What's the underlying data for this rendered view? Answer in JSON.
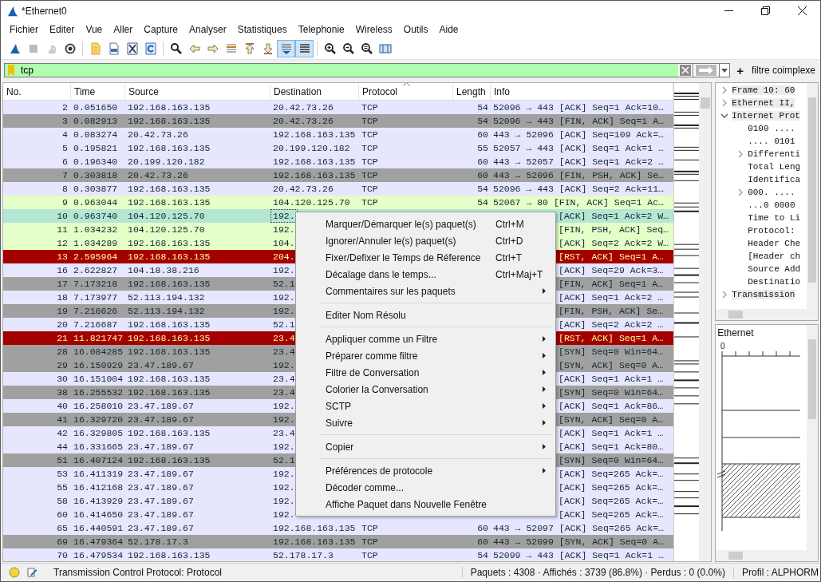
{
  "window": {
    "title": "*Ethernet0"
  },
  "menu_bar": [
    "Fichier",
    "Editer",
    "Vue",
    "Aller",
    "Capture",
    "Analyser",
    "Statistiques",
    "Telephonie",
    "Wireless",
    "Outils",
    "Aide"
  ],
  "toolbar": [
    {
      "kind": "start",
      "on": false,
      "disabled": false
    },
    {
      "kind": "stop",
      "on": false,
      "disabled": true
    },
    {
      "kind": "restart",
      "on": false,
      "disabled": true
    },
    {
      "kind": "options",
      "on": false,
      "disabled": false
    },
    {
      "kind": "open",
      "on": false,
      "disabled": false
    },
    {
      "kind": "save",
      "on": false,
      "disabled": false
    },
    {
      "kind": "close",
      "on": false,
      "disabled": false
    },
    {
      "kind": "reload",
      "on": false,
      "disabled": false
    },
    {
      "kind": "find",
      "on": false,
      "disabled": false
    },
    {
      "kind": "back",
      "on": false,
      "disabled": false
    },
    {
      "kind": "forward",
      "on": false,
      "disabled": false
    },
    {
      "kind": "goto",
      "on": false,
      "disabled": false
    },
    {
      "kind": "first",
      "on": false,
      "disabled": false
    },
    {
      "kind": "last",
      "on": false,
      "disabled": false
    },
    {
      "kind": "autoscroll",
      "on": true,
      "disabled": false
    },
    {
      "kind": "colorize",
      "on": true,
      "disabled": false
    },
    {
      "kind": "zoom_in",
      "on": false,
      "disabled": false
    },
    {
      "kind": "zoom_out",
      "on": false,
      "disabled": false
    },
    {
      "kind": "zoom_reset",
      "on": false,
      "disabled": false
    },
    {
      "kind": "resize",
      "on": false,
      "disabled": false
    }
  ],
  "filter": {
    "value": "tcp",
    "plus": "+",
    "button": "filtre coimplexe"
  },
  "columns": [
    {
      "label": "No.",
      "sorted": false
    },
    {
      "label": "Time",
      "sorted": false
    },
    {
      "label": "Source",
      "sorted": false
    },
    {
      "label": "Destination",
      "sorted": false
    },
    {
      "label": "Protocol",
      "sorted": true
    },
    {
      "label": "Length",
      "sorted": false
    },
    {
      "label": "Info",
      "sorted": false
    }
  ],
  "packets": [
    {
      "no": "2",
      "time": "0.051650",
      "source": "192.168.163.135",
      "destination": "20.42.73.26",
      "protocol": "TCP",
      "length": "54",
      "info": "52096 → 443 [ACK] Seq=1 Ack=10…",
      "kind": "plain",
      "selected": false
    },
    {
      "no": "3",
      "time": "0.082913",
      "source": "192.168.163.135",
      "destination": "20.42.73.26",
      "protocol": "TCP",
      "length": "54",
      "info": "52096 → 443 [FIN, ACK] Seq=1 A…",
      "kind": "flags",
      "selected": false
    },
    {
      "no": "4",
      "time": "0.083274",
      "source": "20.42.73.26",
      "destination": "192.168.163.135",
      "protocol": "TCP",
      "length": "60",
      "info": "443 → 52096 [ACK] Seq=109 Ack=…",
      "kind": "plain",
      "selected": false
    },
    {
      "no": "5",
      "time": "0.195821",
      "source": "192.168.163.135",
      "destination": "20.199.120.182",
      "protocol": "TCP",
      "length": "55",
      "info": "52057 → 443 [ACK] Seq=1 Ack=1 …",
      "kind": "plain",
      "selected": false
    },
    {
      "no": "6",
      "time": "0.196340",
      "source": "20.199.120.182",
      "destination": "192.168.163.135",
      "protocol": "TCP",
      "length": "60",
      "info": "443 → 52057 [ACK] Seq=1 Ack=2 …",
      "kind": "plain",
      "selected": false
    },
    {
      "no": "7",
      "time": "0.303818",
      "source": "20.42.73.26",
      "destination": "192.168.163.135",
      "protocol": "TCP",
      "length": "60",
      "info": "443 → 52096 [FIN, PSH, ACK] Se…",
      "kind": "flags",
      "selected": false
    },
    {
      "no": "8",
      "time": "0.303877",
      "source": "192.168.163.135",
      "destination": "20.42.73.26",
      "protocol": "TCP",
      "length": "54",
      "info": "52096 → 443 [ACK] Seq=2 Ack=11…",
      "kind": "plain",
      "selected": false
    },
    {
      "no": "9",
      "time": "0.963044",
      "source": "192.168.163.135",
      "destination": "104.120.125.70",
      "protocol": "TCP",
      "length": "54",
      "info": "52067 → 80 [FIN, ACK] Seq=1 Ac…",
      "kind": "http",
      "selected": false
    },
    {
      "no": "10",
      "time": "0.963740",
      "source": "104.120.125.70",
      "destination": "192.",
      "info": "[ACK] Seq=1 Ack=2 W…",
      "kind": "http",
      "selected": true
    },
    {
      "no": "11",
      "time": "1.034232",
      "source": "104.120.125.70",
      "destination": "192.",
      "info": "[FIN, PSH, ACK] Seq…",
      "kind": "http",
      "selected": false
    },
    {
      "no": "12",
      "time": "1.034289",
      "source": "192.168.163.135",
      "destination": "104.",
      "info": "[ACK] Seq=2 Ack=2 W…",
      "kind": "http",
      "selected": false
    },
    {
      "no": "13",
      "time": "2.595964",
      "source": "192.168.163.135",
      "destination": "204.",
      "info": "[RST, ACK] Seq=1 A…",
      "kind": "reset",
      "selected": false
    },
    {
      "no": "16",
      "time": "2.622827",
      "source": "104.18.38.216",
      "destination": "192.",
      "info": "[ACK] Seq=29 Ack=3…",
      "kind": "plain",
      "selected": false
    },
    {
      "no": "17",
      "time": "7.173218",
      "source": "192.168.163.135",
      "destination": "52.1",
      "info": "[FIN, ACK] Seq=1 A…",
      "kind": "flags",
      "selected": false
    },
    {
      "no": "18",
      "time": "7.173977",
      "source": "52.113.194.132",
      "destination": "192.",
      "info": "[ACK] Seq=1 Ack=2 …",
      "kind": "plain",
      "selected": false
    },
    {
      "no": "19",
      "time": "7.216626",
      "source": "52.113.194.132",
      "destination": "192.",
      "info": "[FIN, PSH, ACK] Se…",
      "kind": "flags",
      "selected": false
    },
    {
      "no": "20",
      "time": "7.216687",
      "source": "192.168.163.135",
      "destination": "52.1",
      "info": "[ACK] Seq=2 Ack=2 …",
      "kind": "plain",
      "selected": false
    },
    {
      "no": "21",
      "time": "11.821747",
      "source": "192.168.163.135",
      "destination": "23.4",
      "info": "[RST, ACK] Seq=1 A…",
      "kind": "reset",
      "selected": false
    },
    {
      "no": "28",
      "time": "16.084285",
      "source": "192.168.163.135",
      "destination": "23.4",
      "info": "[SYN] Seq=0 Win=64…",
      "kind": "flags",
      "selected": false
    },
    {
      "no": "29",
      "time": "16.150929",
      "source": "23.47.189.67",
      "destination": "192.",
      "info": "[SYN, ACK] Seq=0 A…",
      "kind": "flags",
      "selected": false
    },
    {
      "no": "30",
      "time": "16.151004",
      "source": "192.168.163.135",
      "destination": "23.4",
      "info": "[ACK] Seq=1 Ack=1 …",
      "kind": "plain",
      "selected": false
    },
    {
      "no": "38",
      "time": "16.255532",
      "source": "192.168.163.135",
      "destination": "23.4",
      "info": "[SYN] Seq=0 Win=64…",
      "kind": "flags",
      "selected": false
    },
    {
      "no": "40",
      "time": "16.258010",
      "source": "23.47.189.67",
      "destination": "192.",
      "info": "[ACK] Seq=1 Ack=86…",
      "kind": "plain",
      "selected": false
    },
    {
      "no": "41",
      "time": "16.329720",
      "source": "23.47.189.67",
      "destination": "192.",
      "info": "[SYN, ACK] Seq=0 A…",
      "kind": "flags",
      "selected": false
    },
    {
      "no": "42",
      "time": "16.329805",
      "source": "192.168.163.135",
      "destination": "23.4",
      "info": "[ACK] Seq=1 Ack=1 …",
      "kind": "plain",
      "selected": false
    },
    {
      "no": "44",
      "time": "16.331665",
      "source": "23.47.189.67",
      "destination": "192.",
      "info": "[ACK] Seq=1 Ack=80…",
      "kind": "plain",
      "selected": false
    },
    {
      "no": "51",
      "time": "16.407124",
      "source": "192.168.163.135",
      "destination": "52.1",
      "info": "[SYN] Seq=0 Win=64…",
      "kind": "flags",
      "selected": false
    },
    {
      "no": "53",
      "time": "16.411319",
      "source": "23.47.189.67",
      "destination": "192.",
      "info": "[ACK] Seq=265 Ack=…",
      "kind": "plain",
      "selected": false
    },
    {
      "no": "55",
      "time": "16.412168",
      "source": "23.47.189.67",
      "destination": "192.",
      "info": "[ACK] Seq=265 Ack=…",
      "kind": "plain",
      "selected": false
    },
    {
      "no": "58",
      "time": "16.413929",
      "source": "23.47.189.67",
      "destination": "192.",
      "info": "[ACK] Seq=265 Ack=…",
      "kind": "plain",
      "selected": false
    },
    {
      "no": "60",
      "time": "16.414650",
      "source": "23.47.189.67",
      "destination": "192.",
      "info": "[ACK] Seq=265 Ack=…",
      "kind": "plain",
      "selected": false
    },
    {
      "no": "65",
      "time": "16.440591",
      "source": "23.47.189.67",
      "destination": "192.168.163.135",
      "protocol": "TCP",
      "length": "60",
      "info": "443 → 52097 [ACK] Seq=265 Ack=…",
      "kind": "plain",
      "selected": false
    },
    {
      "no": "69",
      "time": "16.479364",
      "source": "52.178.17.3",
      "destination": "192.168.163.135",
      "protocol": "TCP",
      "length": "60",
      "info": "443 → 52099 [SYN, ACK] Seq=0 A…",
      "kind": "flags",
      "selected": false
    },
    {
      "no": "70",
      "time": "16.479534",
      "source": "192.168.163.135",
      "destination": "52.178.17.3",
      "protocol": "TCP",
      "length": "54",
      "info": "52099 → 443 [ACK] Seq=1 Ack=1 …",
      "kind": "plain",
      "selected": false
    }
  ],
  "context_menu": [
    {
      "kind": "item",
      "label": "Marquer/Démarquer le(s) paquet(s)",
      "shortcut": "Ctrl+M",
      "submenu": false
    },
    {
      "kind": "item",
      "label": "Ignorer/Annuler le(s) paquet(s)",
      "shortcut": "Ctrl+D",
      "submenu": false
    },
    {
      "kind": "item",
      "label": "Fixer/Defixer le Temps de Réference",
      "shortcut": "Ctrl+T",
      "submenu": false
    },
    {
      "kind": "item",
      "label": "Décalage dans le temps...",
      "shortcut": "Ctrl+Maj+T",
      "submenu": false
    },
    {
      "kind": "item",
      "label": "Commentaires sur les paquets",
      "submenu": true
    },
    {
      "kind": "separator"
    },
    {
      "kind": "item",
      "label": "Editer Nom Résolu",
      "submenu": false
    },
    {
      "kind": "separator"
    },
    {
      "kind": "item",
      "label": "Appliquer comme un Filtre",
      "submenu": true
    },
    {
      "kind": "item",
      "label": "Préparer comme filtre",
      "submenu": true
    },
    {
      "kind": "item",
      "label": "Filtre de Conversation",
      "submenu": true
    },
    {
      "kind": "item",
      "label": "Colorier la Conversation",
      "submenu": true
    },
    {
      "kind": "item",
      "label": "SCTP",
      "submenu": true
    },
    {
      "kind": "item",
      "label": "Suivre",
      "submenu": true
    },
    {
      "kind": "separator"
    },
    {
      "kind": "item",
      "label": "Copier",
      "submenu": true
    },
    {
      "kind": "separator"
    },
    {
      "kind": "item",
      "label": "Préférences de protocole",
      "submenu": true
    },
    {
      "kind": "item",
      "label": "Décoder comme...",
      "submenu": false
    },
    {
      "kind": "item",
      "label": "Affiche Paquet dans Nouvelle Fenêtre",
      "submenu": false
    }
  ],
  "details": [
    {
      "label": "Frame 10: 60",
      "expanded": false
    },
    {
      "label": "Ethernet II,",
      "expanded": false
    },
    {
      "label": "Internet Prot",
      "expanded": true,
      "children": [
        {
          "label": "0100 ...."
        },
        {
          "label": ".... 0101"
        },
        {
          "label": "Differenti",
          "expanded": false
        },
        {
          "label": "Total Leng"
        },
        {
          "label": "Identifica"
        },
        {
          "label": "000. ....",
          "expanded": false
        },
        {
          "label": "...0 0000"
        },
        {
          "label": "Time to Li"
        },
        {
          "label": "Protocol:"
        },
        {
          "label": "Header Che"
        },
        {
          "label": "[Header ch"
        },
        {
          "label": "Source Add"
        },
        {
          "label": "Destinatio"
        }
      ]
    },
    {
      "label": "Transmission",
      "expanded": false
    }
  ],
  "bytes_pane": {
    "title": "Ethernet",
    "ruler_start": "0"
  },
  "status_bar": {
    "message": "Transmission Control Protocol: Protocol",
    "stats": "Paquets : 4308 · Affichés : 3739 (86.8%) · Perdus : 0 (0.0%)",
    "profile": "Profil : ALPHORM"
  }
}
